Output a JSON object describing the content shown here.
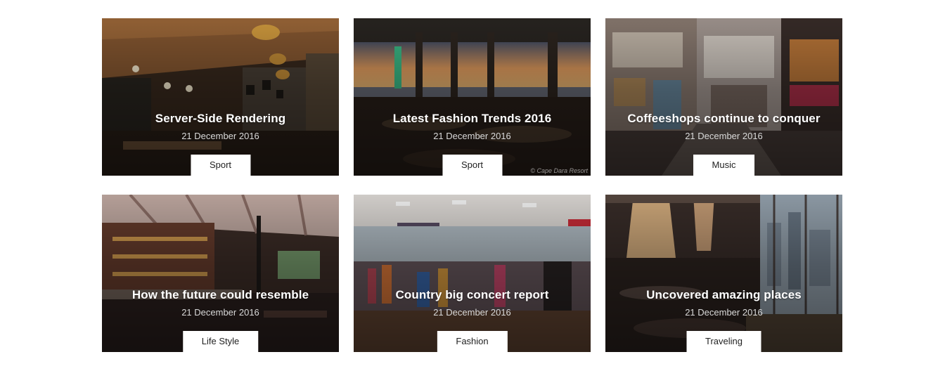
{
  "posts": [
    {
      "title": "Server-Side Rendering",
      "date": "21 December 2016",
      "category": "Sport"
    },
    {
      "title": "Latest Fashion Trends 2016",
      "date": "21 December 2016",
      "category": "Sport",
      "credit": "© Cape Dara Resort"
    },
    {
      "title": "Coffeeshops continue to conquer",
      "date": "21 December 2016",
      "category": "Music"
    },
    {
      "title": "How the future could resemble",
      "date": "21 December 2016",
      "category": "Life Style"
    },
    {
      "title": "Country big concert report",
      "date": "21 December 2016",
      "category": "Fashion"
    },
    {
      "title": "Uncovered amazing places",
      "date": "21 December 2016",
      "category": "Traveling"
    }
  ]
}
